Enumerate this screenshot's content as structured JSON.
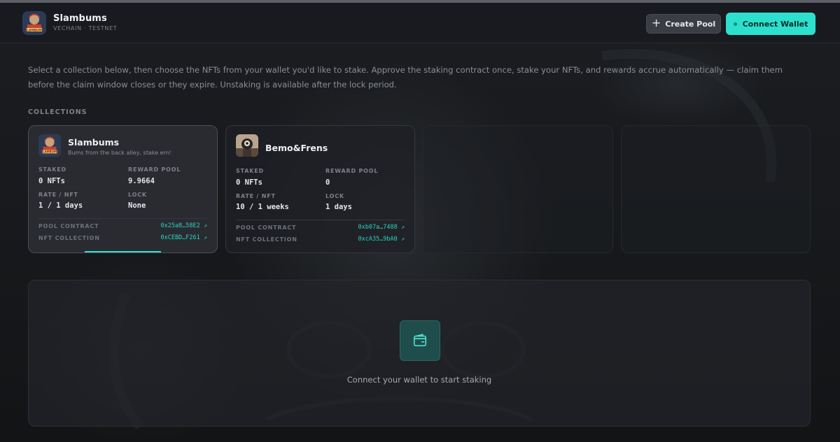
{
  "app": {
    "name": "Slambums",
    "network": "VECHAIN · TESTNET",
    "logo_text": "SLAMBUMS"
  },
  "header": {
    "create_pool_label": "Create Pool",
    "connect_wallet_label": "Connect Wallet"
  },
  "intro_text": "Select a collection below, then choose the NFTs from your wallet you'd like to stake. Approve the staking contract once, stake your NFTs, and rewards accrue automatically — claim them before the claim window closes or they expire. Unstaking is available after the lock period.",
  "collections_label": "COLLECTIONS",
  "collections": [
    {
      "name": "Slambums",
      "tagline": "Bums from the back alley, stake em!",
      "staked_label": "STAKED",
      "staked": "0 NFTs",
      "reward_pool_label": "REWARD POOL",
      "reward_pool": "9.9664",
      "rate_label": "RATE / NFT",
      "rate": "1 / 1 days",
      "lock_label": "LOCK",
      "lock": "None",
      "pool_contract_label": "POOL CONTRACT",
      "pool_contract": "0x25a8…58E2 ↗",
      "nft_collection_label": "NFT COLLECTION",
      "nft_collection": "0xCEBD…F261 ↗"
    },
    {
      "name": "Bemo&Frens",
      "tagline": "",
      "staked_label": "STAKED",
      "staked": "0 NFTs",
      "reward_pool_label": "REWARD POOL",
      "reward_pool": "0",
      "rate_label": "RATE / NFT",
      "rate": "10 / 1 weeks",
      "lock_label": "LOCK",
      "lock": "1 days",
      "pool_contract_label": "POOL CONTRACT",
      "pool_contract": "0xb07a…7488 ↗",
      "nft_collection_label": "NFT COLLECTION",
      "nft_collection": "0xcA35…9bA0 ↗"
    }
  ],
  "stage": {
    "icon": "wallet-icon",
    "message": "Connect your wallet to start staking"
  },
  "colors": {
    "accent": "#2de0cd",
    "background": "#141619",
    "card": "#2c2e34"
  }
}
